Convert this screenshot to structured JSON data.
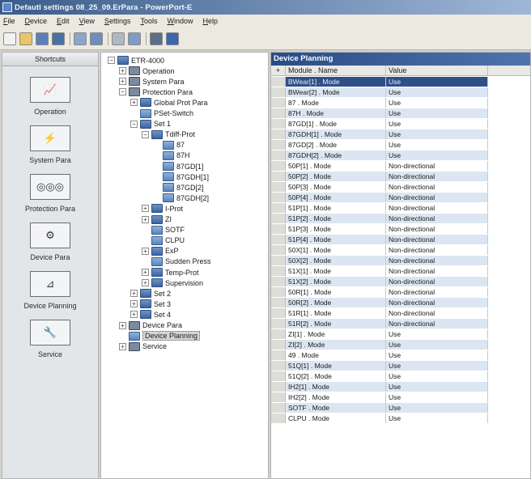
{
  "window": {
    "title": "Defautl settings 08_25_09.ErPara - PowerPort-E"
  },
  "menu": [
    "File",
    "Device",
    "Edit",
    "View",
    "Settings",
    "Tools",
    "Window",
    "Help"
  ],
  "toolbar_icons": [
    "new-file-icon",
    "open-folder-icon",
    "save-icon",
    "device-icon",
    "zoom-icon",
    "refresh-icon",
    "edit-icon",
    "calculator-icon",
    "print-icon",
    "help-icon"
  ],
  "shortcuts": {
    "header": "Shortcuts",
    "items": [
      {
        "label": "Operation",
        "icon": "chart-icon"
      },
      {
        "label": "System Para",
        "icon": "breaker-icon"
      },
      {
        "label": "Protection Para",
        "icon": "relay-icon"
      },
      {
        "label": "Device Para",
        "icon": "device-settings-icon"
      },
      {
        "label": "Device Planning",
        "icon": "planning-icon"
      },
      {
        "label": "Service",
        "icon": "wrench-icon"
      }
    ]
  },
  "tree": [
    {
      "label": "ETR-4000",
      "level": 0,
      "expander": "−",
      "icon": "folder"
    },
    {
      "label": "Operation",
      "level": 1,
      "expander": "+",
      "icon": "sys"
    },
    {
      "label": "System Para",
      "level": 1,
      "expander": "+",
      "icon": "sys"
    },
    {
      "label": "Protection Para",
      "level": 1,
      "expander": "−",
      "icon": "sys"
    },
    {
      "label": "Global Prot Para",
      "level": 2,
      "expander": "+",
      "icon": "folder"
    },
    {
      "label": "PSet-Switch",
      "level": 2,
      "expander": "",
      "icon": "leaf"
    },
    {
      "label": "Set 1",
      "level": 2,
      "expander": "−",
      "icon": "folder"
    },
    {
      "label": "Tdiff-Prot",
      "level": 3,
      "expander": "−",
      "icon": "folder"
    },
    {
      "label": "87",
      "level": 4,
      "expander": "",
      "icon": "leaf"
    },
    {
      "label": "87H",
      "level": 4,
      "expander": "",
      "icon": "leaf"
    },
    {
      "label": "87GD[1]",
      "level": 4,
      "expander": "",
      "icon": "leaf"
    },
    {
      "label": "87GDH[1]",
      "level": 4,
      "expander": "",
      "icon": "leaf"
    },
    {
      "label": "87GD[2]",
      "level": 4,
      "expander": "",
      "icon": "leaf"
    },
    {
      "label": "87GDH[2]",
      "level": 4,
      "expander": "",
      "icon": "leaf"
    },
    {
      "label": "I-Prot",
      "level": 3,
      "expander": "+",
      "icon": "folder"
    },
    {
      "label": "ZI",
      "level": 3,
      "expander": "+",
      "icon": "folder"
    },
    {
      "label": "SOTF",
      "level": 3,
      "expander": "",
      "icon": "leaf"
    },
    {
      "label": "CLPU",
      "level": 3,
      "expander": "",
      "icon": "leaf"
    },
    {
      "label": "ExP",
      "level": 3,
      "expander": "+",
      "icon": "folder"
    },
    {
      "label": "Sudden Press",
      "level": 3,
      "expander": "",
      "icon": "leaf"
    },
    {
      "label": "Temp-Prot",
      "level": 3,
      "expander": "+",
      "icon": "folder"
    },
    {
      "label": "Supervision",
      "level": 3,
      "expander": "+",
      "icon": "folder"
    },
    {
      "label": "Set 2",
      "level": 2,
      "expander": "+",
      "icon": "folder"
    },
    {
      "label": "Set 3",
      "level": 2,
      "expander": "+",
      "icon": "folder"
    },
    {
      "label": "Set 4",
      "level": 2,
      "expander": "+",
      "icon": "folder"
    },
    {
      "label": "Device Para",
      "level": 1,
      "expander": "+",
      "icon": "sys"
    },
    {
      "label": "Device Planning",
      "level": 1,
      "expander": "",
      "icon": "leaf",
      "selected": true
    },
    {
      "label": "Service",
      "level": 1,
      "expander": "+",
      "icon": "sys"
    }
  ],
  "grid": {
    "title": "Device Planning",
    "corner": "+",
    "columns": [
      "Module . Name",
      "Value"
    ],
    "rows": [
      [
        "BWear[1] . Mode",
        "Use"
      ],
      [
        "BWear[2] . Mode",
        "Use"
      ],
      [
        "87 . Mode",
        "Use"
      ],
      [
        "87H . Mode",
        "Use"
      ],
      [
        "87GD[1] . Mode",
        "Use"
      ],
      [
        "87GDH[1] . Mode",
        "Use"
      ],
      [
        "87GD[2] . Mode",
        "Use"
      ],
      [
        "87GDH[2] . Mode",
        "Use"
      ],
      [
        "50P[1] . Mode",
        "Non-directional"
      ],
      [
        "50P[2] . Mode",
        "Non-directional"
      ],
      [
        "50P[3] . Mode",
        "Non-directional"
      ],
      [
        "50P[4] . Mode",
        "Non-directional"
      ],
      [
        "51P[1] . Mode",
        "Non-directional"
      ],
      [
        "51P[2] . Mode",
        "Non-directional"
      ],
      [
        "51P[3] . Mode",
        "Non-directional"
      ],
      [
        "51P[4] . Mode",
        "Non-directional"
      ],
      [
        "50X[1] . Mode",
        "Non-directional"
      ],
      [
        "50X[2] . Mode",
        "Non-directional"
      ],
      [
        "51X[1] . Mode",
        "Non-directional"
      ],
      [
        "51X[2] . Mode",
        "Non-directional"
      ],
      [
        "50R[1] . Mode",
        "Non-directional"
      ],
      [
        "50R[2] . Mode",
        "Non-directional"
      ],
      [
        "51R[1] . Mode",
        "Non-directional"
      ],
      [
        "51R[2] . Mode",
        "Non-directional"
      ],
      [
        "ZI[1] . Mode",
        "Use"
      ],
      [
        "ZI[2] . Mode",
        "Use"
      ],
      [
        "49 . Mode",
        "Use"
      ],
      [
        "51Q[1] . Mode",
        "Use"
      ],
      [
        "51Q[2] . Mode",
        "Use"
      ],
      [
        "IH2[1] . Mode",
        "Use"
      ],
      [
        "IH2[2] . Mode",
        "Use"
      ],
      [
        "SOTF . Mode",
        "Use"
      ],
      [
        "CLPU . Mode",
        "Use"
      ]
    ]
  },
  "colors": {
    "title_bar": "#3a5c8c",
    "grid_header": "#2a4c86",
    "selected_row": "#2f4f88",
    "alt_row": "#dbe6f2"
  }
}
